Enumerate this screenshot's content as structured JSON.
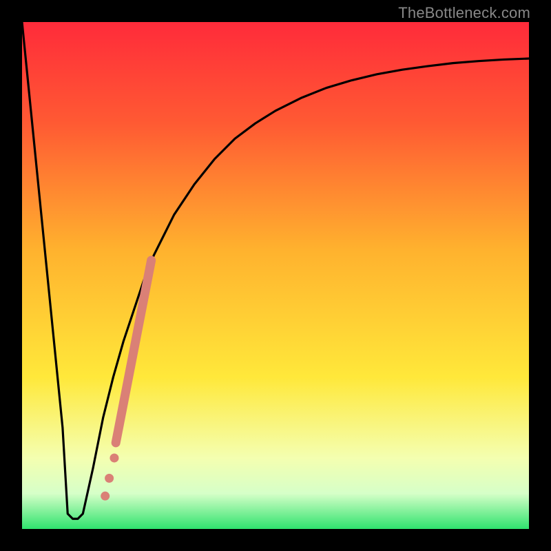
{
  "attribution": "TheBottleneck.com",
  "colors": {
    "frame": "#000000",
    "curve": "#000000",
    "dots": "#da8076",
    "gradient_top": "#ff2b3a",
    "gradient_mid_upper": "#ff8a2e",
    "gradient_mid": "#ffe83a",
    "gradient_lower": "#f4ffb0",
    "gradient_band": "#d6ffc8",
    "gradient_bottom": "#2fe36e"
  },
  "chart_data": {
    "type": "line",
    "title": "",
    "xlabel": "",
    "ylabel": "",
    "xlim": [
      0,
      100
    ],
    "ylim": [
      0,
      100
    ],
    "grid": false,
    "legend": false,
    "series": [
      {
        "name": "bottleneck-curve",
        "x": [
          0,
          2,
          4,
          6,
          8,
          9,
          10,
          11,
          12,
          14,
          16,
          18,
          20,
          22,
          24,
          26,
          28,
          30,
          34,
          38,
          42,
          46,
          50,
          55,
          60,
          65,
          70,
          75,
          80,
          85,
          90,
          95,
          100
        ],
        "y": [
          100,
          80,
          60,
          40,
          20,
          3,
          2,
          2,
          3,
          12,
          22,
          30,
          37,
          43,
          49,
          54,
          58,
          62,
          68,
          73,
          77,
          80,
          82.5,
          85,
          87,
          88.5,
          89.7,
          90.6,
          91.3,
          91.9,
          92.3,
          92.6,
          92.8
        ]
      }
    ],
    "flat_segment": {
      "x_start": 9,
      "x_end": 11,
      "y": 2
    },
    "overlay_points": {
      "name": "highlight-dots",
      "segment": {
        "x_start": 18.5,
        "y_start": 17,
        "x_end": 25.5,
        "y_end": 53
      },
      "isolated": [
        {
          "x": 17.2,
          "y": 10
        },
        {
          "x": 18.2,
          "y": 14
        },
        {
          "x": 16.4,
          "y": 6.5
        }
      ]
    },
    "background_gradient_stops": [
      {
        "offset": 0.0,
        "color": "#ff2b3a"
      },
      {
        "offset": 0.2,
        "color": "#ff5a33"
      },
      {
        "offset": 0.45,
        "color": "#ffb22e"
      },
      {
        "offset": 0.7,
        "color": "#ffe83a"
      },
      {
        "offset": 0.86,
        "color": "#f4ffb0"
      },
      {
        "offset": 0.93,
        "color": "#d6ffc8"
      },
      {
        "offset": 1.0,
        "color": "#2fe36e"
      }
    ]
  }
}
